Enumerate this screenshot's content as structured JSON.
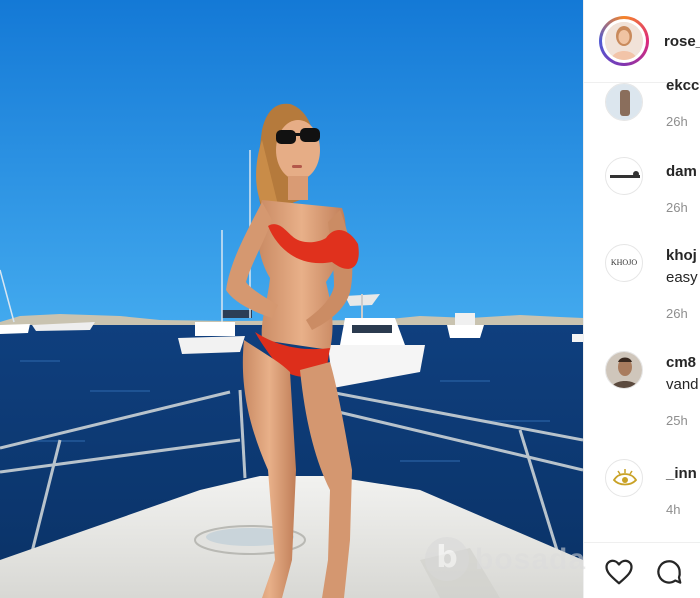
{
  "post": {
    "username": "rose_",
    "image_alt": "Woman in red bikini and sunglasses standing on the bow of a boat, sea and yachts in background"
  },
  "comments": [
    {
      "user": "ekcc",
      "text": "",
      "time": "26h",
      "avatar": "photo-avatar"
    },
    {
      "user": "dam",
      "text": "",
      "time": "26h",
      "avatar": "brand-logo-avatar"
    },
    {
      "user": "khoj",
      "text": "easy",
      "time": "26h",
      "avatar_text": "KHOJO"
    },
    {
      "user": "cm8",
      "text": "vand",
      "time": "25h",
      "avatar": "photo-avatar"
    },
    {
      "user": "_inn",
      "text": "",
      "time": "4h",
      "avatar": "eye-logo-avatar"
    }
  ],
  "actions": {
    "like_icon": "heart-icon",
    "comment_icon": "comment-icon"
  },
  "watermark": {
    "logo_letter": "b",
    "text": "bosada"
  },
  "colors": {
    "sky": "#1f8fe0",
    "sea": "#0d3d7a",
    "bikini": "#e0311d",
    "text": "#262626",
    "muted": "#8e8e8e"
  }
}
